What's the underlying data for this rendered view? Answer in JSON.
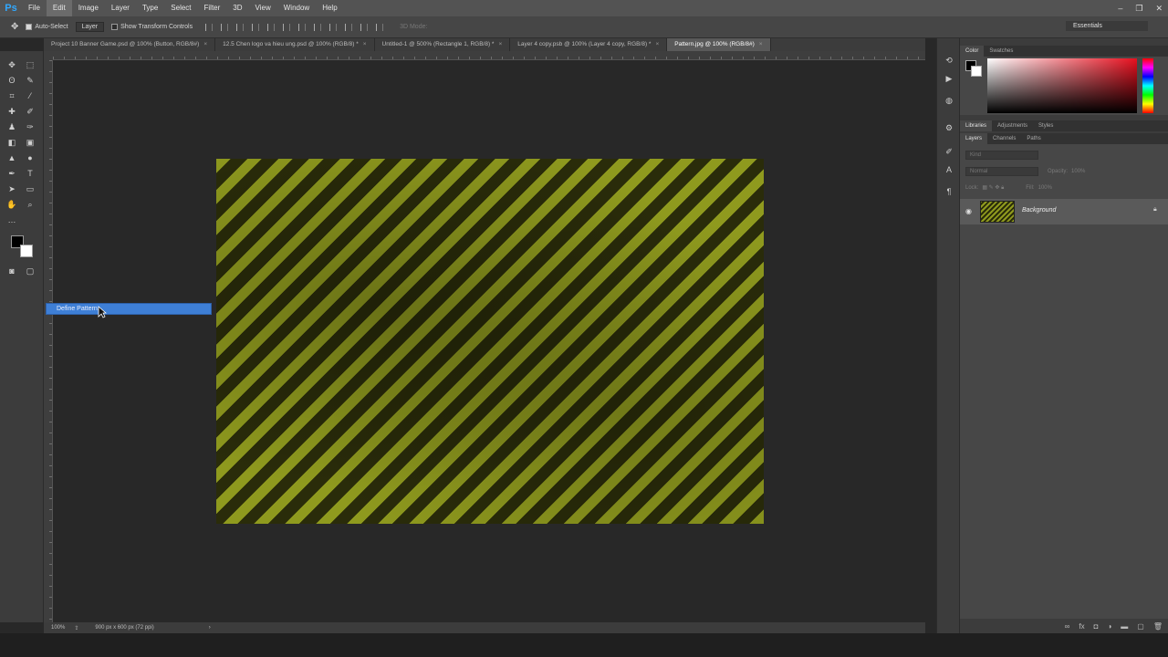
{
  "app": {
    "logo": "Ps"
  },
  "menu": [
    "File",
    "Edit",
    "Image",
    "Layer",
    "Type",
    "Select",
    "Filter",
    "3D",
    "View",
    "Window",
    "Help"
  ],
  "options": {
    "auto_select_label": "Auto-Select",
    "auto_select_value": "Layer",
    "show_transform_label": "Show Transform Controls",
    "mode_3d": "3D Mode:",
    "workspace": "Essentials"
  },
  "tabs": [
    "Project 10 Banner Game.psd @ 100% (Button, RGB/8#)",
    "12.5 Chen logo va hieu ung.psd @ 100% (RGB/8) *",
    "Untitled-1 @ 500% (Rectangle 1, RGB/8) *",
    "Layer 4 copy.psb @ 100% (Layer 4 copy, RGB/8) *",
    "Pattern.jpg @ 100% (RGB/8#)"
  ],
  "context_menu": {
    "item": "Define Pattern..."
  },
  "status": {
    "zoom": "100%",
    "doc_info": "900 px x 600 px (72 ppi)"
  },
  "color_panel": {
    "tabs": [
      "Color",
      "Swatches"
    ]
  },
  "libraries_tabs": [
    "Libraries",
    "Adjustments",
    "Styles"
  ],
  "layers_panel": {
    "tabs": [
      "Layers",
      "Channels",
      "Paths"
    ],
    "kind_label": "Kind",
    "blend_mode": "Normal",
    "opacity_label": "Opacity:",
    "opacity_value": "100%",
    "lock_label": "Lock:",
    "fill_label": "Fill:",
    "fill_value": "100%",
    "layers": [
      {
        "name": "Background"
      }
    ]
  },
  "colors": {
    "accent": "#3e7fd6",
    "stripe_light": "#8f9a1e",
    "stripe_dark": "#2a2c0a"
  }
}
